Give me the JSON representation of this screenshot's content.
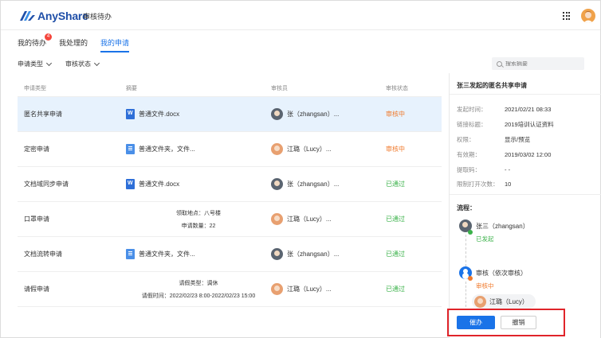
{
  "app": {
    "logo_text": "AnyShare",
    "title": "审核待办"
  },
  "tabs": [
    {
      "label": "我的待办",
      "badge": "4"
    },
    {
      "label": "我处理的"
    },
    {
      "label": "我的申请"
    }
  ],
  "filters": {
    "type_label": "申请类型",
    "status_label": "审核状态"
  },
  "search": {
    "placeholder": "搜索摘要"
  },
  "table": {
    "headers": [
      "申请类型",
      "摘要",
      "审核员",
      "审核状态"
    ],
    "rows": [
      {
        "type": "匿名共享申请",
        "summary": "普通文件.docx",
        "approver": "张（zhangsan）...",
        "status": "审核中"
      },
      {
        "type": "定密申请",
        "summary": "普通文件夹，文件...",
        "approver": "江璐（Lucy）...",
        "status": "审核中"
      },
      {
        "type": "文档域同步申请",
        "summary": "普通文件.docx",
        "approver": "张（zhangsan）...",
        "status": "已通过"
      },
      {
        "type": "口罩申请",
        "summary_line1": "领取地点：八号楼",
        "summary_line2": "申请数量：22",
        "approver": "江璐（Lucy）...",
        "status": "已通过"
      },
      {
        "type": "文档流转申请",
        "summary": "普通文件夹，文件...",
        "approver": "张（zhangsan）...",
        "status": "已通过"
      },
      {
        "type": "请假申请",
        "summary_line1": "请假类型：调休",
        "summary_line2": "请假时间：2022/02/23 8:00-2022/02/23 15:00",
        "approver": "江璐（Lucy）...",
        "status": "已通过"
      }
    ]
  },
  "detail": {
    "title": "张三发起的匿名共享申请",
    "fields": [
      {
        "k": "发起时间：",
        "v": "2021/02/21 08:33"
      },
      {
        "k": "链接标题：",
        "v": "2019培训认证资料"
      },
      {
        "k": "权限：",
        "v": "显示/预览"
      },
      {
        "k": "有效期：",
        "v": "2019/03/02 12:00"
      },
      {
        "k": "提取码：",
        "v": "- -"
      },
      {
        "k": "限制打开次数：",
        "v": "10"
      }
    ],
    "flow_title": "流程：",
    "flow": {
      "initiator": "张三（zhangsan）",
      "initiator_status": "已发起",
      "review": "审核（依次审核）",
      "review_status": "审核中",
      "reviewer": "江璐（Lucy）"
    }
  },
  "actions": {
    "urge": "催办",
    "revoke": "撤销"
  },
  "colors": {
    "primary": "#1a73e8",
    "pending": "#f07a2c",
    "approved": "#3bb24a",
    "highlight": "#e0242a"
  }
}
